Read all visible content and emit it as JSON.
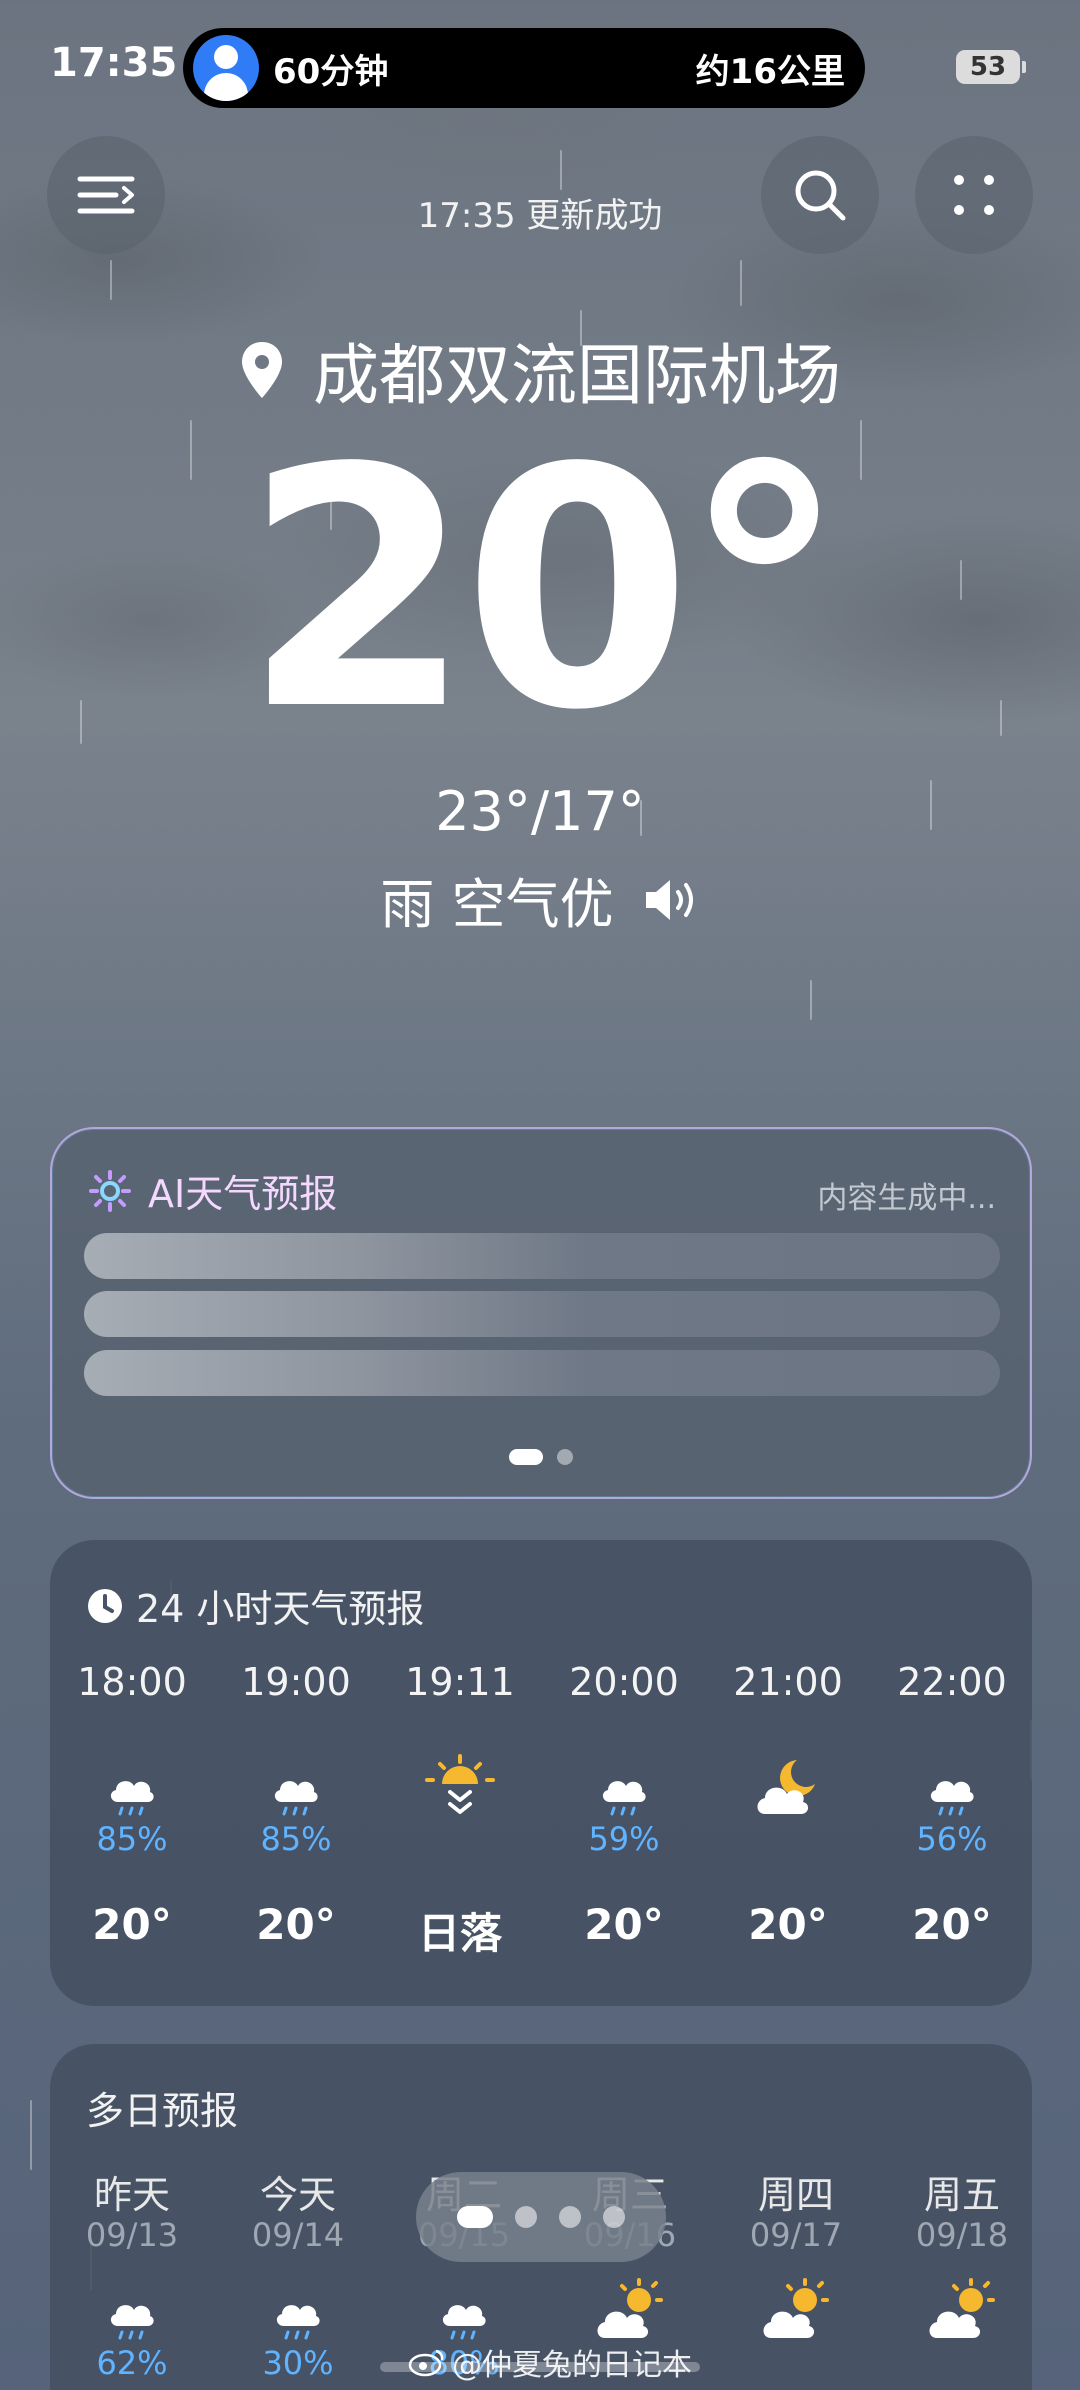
{
  "status_bar": {
    "time": "17:35",
    "island_left": "60分钟",
    "island_right": "约16公里",
    "battery": "53"
  },
  "header": {
    "update_text": "17:35 更新成功",
    "menu_icon": "menu-icon",
    "search_icon": "search-icon",
    "more_icon": "grid-dots-icon"
  },
  "current": {
    "location": "成都双流国际机场",
    "temperature": "20°",
    "high_low": "23°/17°",
    "condition": "雨 空气优"
  },
  "ai_forecast": {
    "title": "AI天气预报",
    "status": "内容生成中..."
  },
  "hourly": {
    "title": "24 小时天气预报",
    "items": [
      {
        "time": "18:00",
        "icon": "cloud-rain-icon",
        "pct": "85%",
        "value": "20°"
      },
      {
        "time": "19:00",
        "icon": "cloud-rain-icon",
        "pct": "85%",
        "value": "20°"
      },
      {
        "time": "19:11",
        "icon": "sunset-icon",
        "pct": "",
        "value": "日落"
      },
      {
        "time": "20:00",
        "icon": "cloud-rain-icon",
        "pct": "59%",
        "value": "20°"
      },
      {
        "time": "21:00",
        "icon": "moon-cloud-icon",
        "pct": "",
        "value": "20°"
      },
      {
        "time": "22:00",
        "icon": "cloud-rain-icon",
        "pct": "56%",
        "value": "20°"
      }
    ]
  },
  "daily": {
    "title": "多日预报",
    "items": [
      {
        "name": "昨天",
        "date": "09/13",
        "icon": "cloud-rain-icon",
        "pct": "62%"
      },
      {
        "name": "今天",
        "date": "09/14",
        "icon": "cloud-rain-icon",
        "pct": "30%"
      },
      {
        "name": "周二",
        "date": "09/15",
        "icon": "cloud-rain-icon",
        "pct": "80%"
      },
      {
        "name": "周三",
        "date": "09/16",
        "icon": "sun-cloud-icon",
        "pct": ""
      },
      {
        "name": "周四",
        "date": "09/17",
        "icon": "sun-cloud-icon",
        "pct": ""
      },
      {
        "name": "周五",
        "date": "09/18",
        "icon": "sun-cloud-icon",
        "pct": ""
      }
    ]
  },
  "watermark": "@仲夏兔的日记本",
  "colors": {
    "precip": "#5fb3ff",
    "sun": "#f5b82e"
  }
}
